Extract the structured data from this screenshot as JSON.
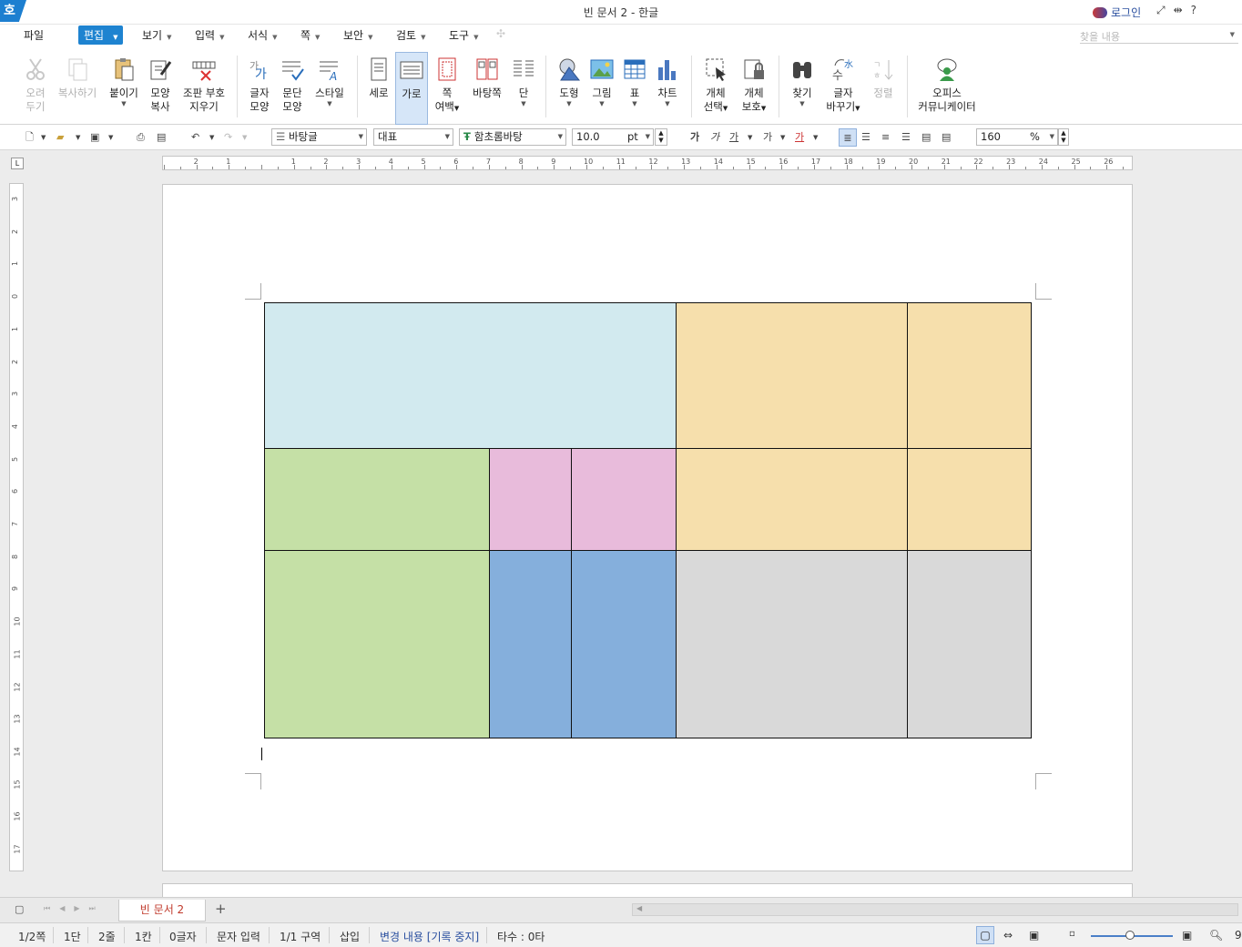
{
  "window": {
    "app_icon": "호",
    "title": "빈 문서 2 - 한글",
    "login": "로그인",
    "controls": [
      "fullscreen-icon",
      "resize-icon",
      "help-icon"
    ],
    "help": "?"
  },
  "menubar": {
    "file": "파일",
    "items": [
      "편집",
      "보기",
      "입력",
      "서식",
      "쪽",
      "보안",
      "검토",
      "도구"
    ],
    "search_placeholder": "찾을 내용"
  },
  "ribbon": {
    "cut": [
      "오려",
      "두기"
    ],
    "copy": "복사하기",
    "paste": "붙이기",
    "format_copy": [
      "모양",
      "복사"
    ],
    "clear_marks": [
      "조판 부호",
      "지우기"
    ],
    "char_shape": [
      "글자",
      "모양"
    ],
    "para_shape": [
      "문단",
      "모양"
    ],
    "style": "스타일",
    "vertical": "세로",
    "horizontal": "가로",
    "margin": [
      "쪽",
      "여백"
    ],
    "background": "바탕쪽",
    "column": "단",
    "shape": "도형",
    "picture": "그림",
    "table": "표",
    "chart": "차트",
    "obj_select": [
      "개체",
      "선택"
    ],
    "obj_protect": [
      "개체",
      "보호"
    ],
    "find": "찾기",
    "replace": [
      "글자",
      "바꾸기"
    ],
    "sort": "정렬",
    "community": [
      "오피스",
      "커뮤니케이터"
    ]
  },
  "formatbar": {
    "style": "바탕글",
    "lang": "대표",
    "font": "함초롬바탕",
    "size": "10.0",
    "unit": "pt",
    "char_buttons": [
      "가",
      "가",
      "가",
      "가",
      "가"
    ],
    "zoom": "160",
    "zoom_unit": "%"
  },
  "ruler": {
    "h_labels": [
      "2",
      "1",
      "1",
      "2",
      "3",
      "4",
      "5",
      "6",
      "7",
      "8",
      "9",
      "10",
      "11",
      "12",
      "13",
      "14",
      "15",
      "16",
      "17",
      "18",
      "19",
      "20",
      "21",
      "22",
      "23",
      "24",
      "25",
      "26"
    ],
    "v_labels": [
      "3",
      "2",
      "1",
      "0",
      "1",
      "2",
      "3",
      "4",
      "5",
      "6",
      "7",
      "8",
      "9",
      "10",
      "11",
      "12",
      "13",
      "14",
      "15",
      "16",
      "17"
    ]
  },
  "table": {
    "colors": {
      "lightblue": "#d2eaef",
      "orange": "#f6dfac",
      "green": "#c5e0a6",
      "pink": "#e8bbdb",
      "blue": "#85afdc",
      "gray": "#d9d9d9"
    }
  },
  "tabs": {
    "doc": "빈 문서 2",
    "add": "+"
  },
  "status": {
    "page": "1/2쪽",
    "column": "1단",
    "line": "2줄",
    "cell": "1칸",
    "chars": "0글자",
    "mode": "문자 입력",
    "section": "1/1 구역",
    "insert": "삽입",
    "track": "변경 내용 [기록 중지]",
    "keystrokes": "타수 : 0타",
    "zoom_short": "9"
  }
}
